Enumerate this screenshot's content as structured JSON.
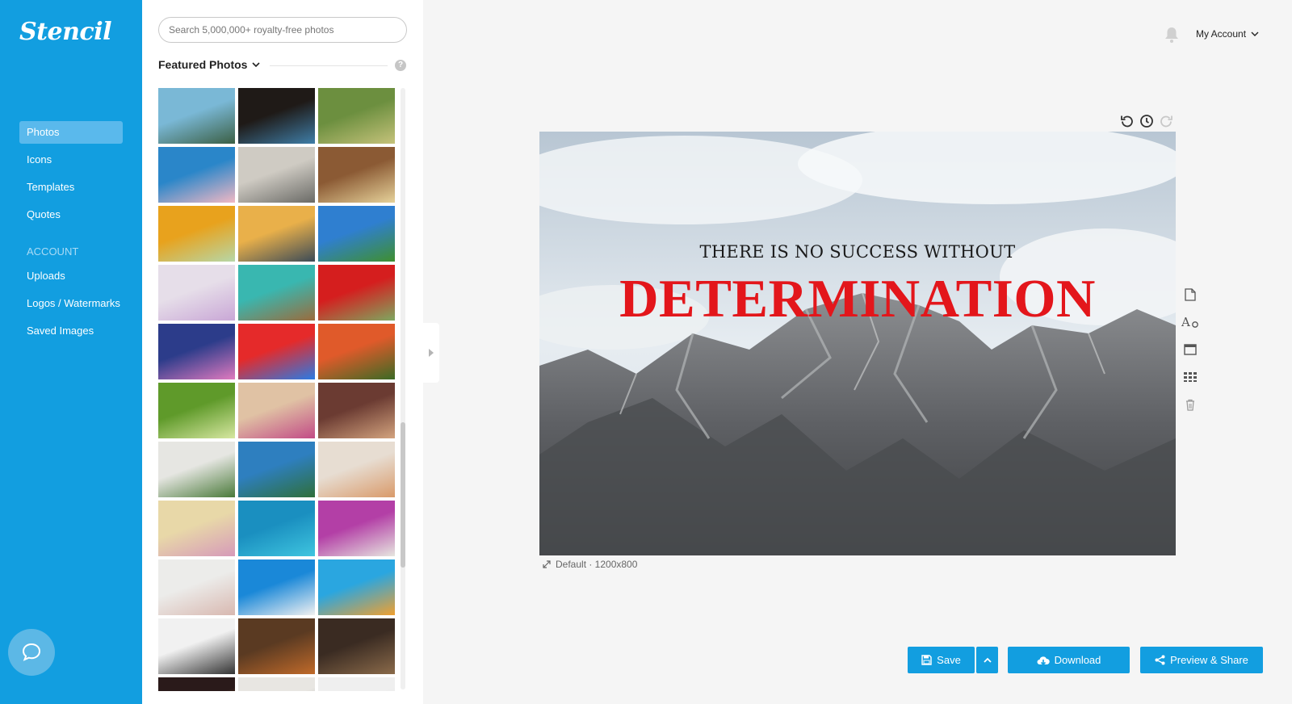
{
  "brand": {
    "logo_text": "Stencil",
    "accent": "#129ee0",
    "headline_red": "#e3161b"
  },
  "nav": {
    "items": [
      {
        "label": "Photos",
        "active": true
      },
      {
        "label": "Icons"
      },
      {
        "label": "Templates"
      },
      {
        "label": "Quotes"
      }
    ],
    "section_label": "ACCOUNT",
    "account_items": [
      {
        "label": "Uploads"
      },
      {
        "label": "Logos / Watermarks"
      },
      {
        "label": "Saved Images"
      }
    ],
    "chat_icon": "chat-bubble-icon"
  },
  "panel": {
    "search_placeholder": "Search 5,000,000+ royalty-free photos",
    "featured_label": "Featured Photos",
    "help_glyph": "?",
    "thumbnails": [
      {
        "name": "palm-trees",
        "colors": [
          "#7ab8d6",
          "#3b5f44"
        ]
      },
      {
        "name": "coffee-cup",
        "colors": [
          "#1f1a17",
          "#3f7ea8"
        ]
      },
      {
        "name": "bird-house",
        "colors": [
          "#6c8f3f",
          "#c5c27a"
        ]
      },
      {
        "name": "paint-swirl",
        "colors": [
          "#2a86c9",
          "#f2b8c4"
        ]
      },
      {
        "name": "beach-dogs",
        "colors": [
          "#cfcbc3",
          "#6a6a66"
        ]
      },
      {
        "name": "laptop-flowers",
        "colors": [
          "#8b5a34",
          "#e6d29a"
        ]
      },
      {
        "name": "sunflower-chalk",
        "colors": [
          "#e8a21d",
          "#b6d7a8"
        ]
      },
      {
        "name": "mountain-sunset",
        "colors": [
          "#e9b04a",
          "#3b4a57"
        ]
      },
      {
        "name": "green-field",
        "colors": [
          "#2f7fd0",
          "#3f8f2f"
        ]
      },
      {
        "name": "candy-eggs",
        "colors": [
          "#e6dee9",
          "#c9a7d6"
        ]
      },
      {
        "name": "man-poolside",
        "colors": [
          "#39b7b0",
          "#9b6b3c"
        ]
      },
      {
        "name": "strawberry",
        "colors": [
          "#d51e1e",
          "#7ea860"
        ]
      },
      {
        "name": "lake-dusk",
        "colors": [
          "#2c3c8a",
          "#e07abf"
        ]
      },
      {
        "name": "jelly-beans",
        "colors": [
          "#e52a2a",
          "#2a7be5"
        ]
      },
      {
        "name": "field-sunset",
        "colors": [
          "#e05a2a",
          "#3b6a25"
        ]
      },
      {
        "name": "palm-leaf",
        "colors": [
          "#5f9a2a",
          "#d7e7a1"
        ]
      },
      {
        "name": "makeup-brushes",
        "colors": [
          "#e0c2a4",
          "#c24b86"
        ]
      },
      {
        "name": "woman-camera",
        "colors": [
          "#6b3b32",
          "#d3a37e"
        ]
      },
      {
        "name": "flower-frame",
        "colors": [
          "#e6e6e2",
          "#4a7a3a"
        ]
      },
      {
        "name": "mountain-lake",
        "colors": [
          "#2e7fbf",
          "#2f6f3a"
        ]
      },
      {
        "name": "crafts-hands",
        "colors": [
          "#e7ddd2",
          "#d99a6a"
        ]
      },
      {
        "name": "girl-flowers",
        "colors": [
          "#e8d8a8",
          "#d69ab9"
        ]
      },
      {
        "name": "swimmer-pool",
        "colors": [
          "#1a8fc0",
          "#3fc5df"
        ]
      },
      {
        "name": "tulips",
        "colors": [
          "#b33fa6",
          "#e6e6df"
        ]
      },
      {
        "name": "easter-bunny",
        "colors": [
          "#ececea",
          "#d8b8b0"
        ]
      },
      {
        "name": "hanging-bulbs",
        "colors": [
          "#1a88d8",
          "#f1f1f1"
        ]
      },
      {
        "name": "ice-cream-pattern",
        "colors": [
          "#2aa6e0",
          "#f0a030"
        ]
      },
      {
        "name": "women-group",
        "colors": [
          "#f1f1f1",
          "#333333"
        ]
      },
      {
        "name": "wood-table-food",
        "colors": [
          "#5a3a22",
          "#c06a2a"
        ]
      },
      {
        "name": "old-doorway",
        "colors": [
          "#3a2b22",
          "#8a6a4a"
        ]
      },
      {
        "name": "night-lights",
        "colors": [
          "#2a1a1a",
          "#e08a3a"
        ]
      },
      {
        "name": "stone-blur",
        "colors": [
          "#e8e6e2",
          "#8a8a8a"
        ]
      },
      {
        "name": "white-plain",
        "colors": [
          "#efefef",
          "#dcdcdc"
        ]
      }
    ]
  },
  "header": {
    "bell_icon": "bell-icon",
    "account_label": "My Account"
  },
  "canvas": {
    "line1": "THERE IS NO SUCCESS WITHOUT",
    "line2": "DETERMINATION",
    "size_label": "Default · 1200x800"
  },
  "history": {
    "undo": "undo-icon",
    "history": "clock-icon",
    "redo": "redo-icon"
  },
  "tools": [
    "page-icon",
    "text-style-icon",
    "frame-icon",
    "grid-icon",
    "trash-icon"
  ],
  "actions": {
    "save": "Save",
    "download": "Download",
    "share": "Preview & Share"
  }
}
